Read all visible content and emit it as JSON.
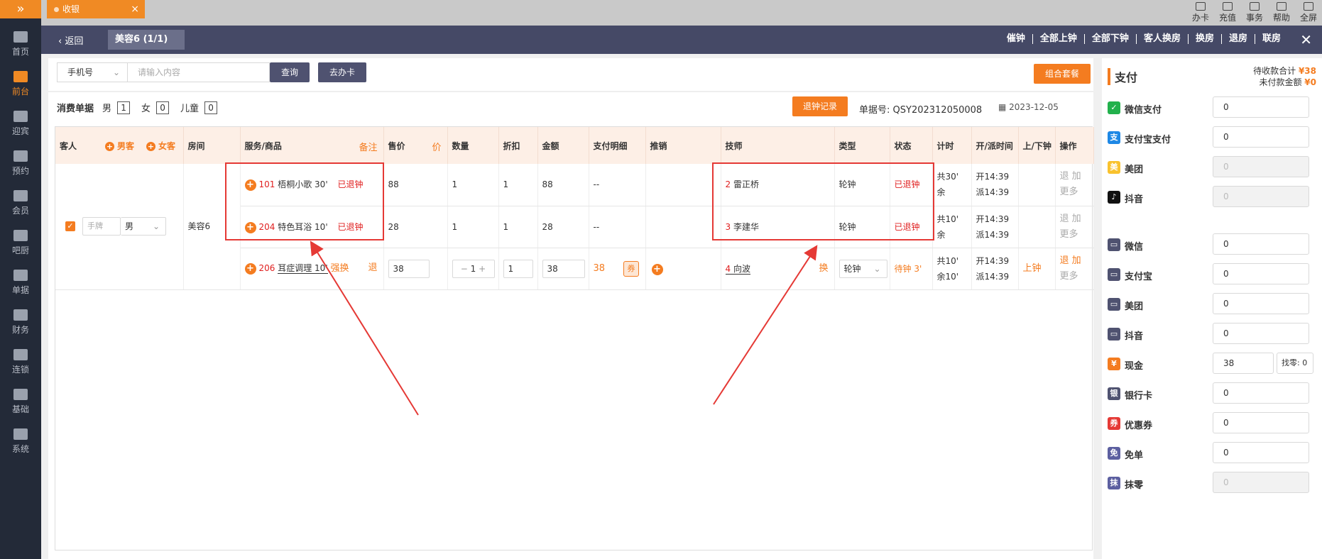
{
  "sidebar": {
    "toggle": "»",
    "items": [
      {
        "label": "首页",
        "icon": "home-icon"
      },
      {
        "label": "前台",
        "icon": "monitor-icon"
      },
      {
        "label": "迎宾",
        "icon": "reception-icon"
      },
      {
        "label": "预约",
        "icon": "calendar-icon"
      },
      {
        "label": "会员",
        "icon": "member-icon"
      },
      {
        "label": "吧厨",
        "icon": "cup-icon"
      },
      {
        "label": "单据",
        "icon": "document-icon"
      },
      {
        "label": "财务",
        "icon": "finance-icon"
      },
      {
        "label": "连锁",
        "icon": "chain-icon"
      },
      {
        "label": "基础",
        "icon": "base-icon"
      },
      {
        "label": "系统",
        "icon": "gear-icon"
      }
    ]
  },
  "topbar": {
    "tab_label": "收银",
    "tab_close": "×",
    "tools": [
      "办卡",
      "充值",
      "事务",
      "帮助",
      "全屏"
    ]
  },
  "navbar": {
    "back_label": "返回",
    "room_tag": "美容6 (1/1)",
    "actions": [
      "催钟",
      "全部上钟",
      "全部下钟",
      "客人换房",
      "换房",
      "退房",
      "联房"
    ],
    "close": "✕"
  },
  "search": {
    "select_value": "手机号",
    "placeholder": "请输入内容",
    "query_label": "查询",
    "card_label": "去办卡",
    "combo_label": "组合套餐"
  },
  "bill": {
    "title": "消费单据",
    "male_label": "男",
    "male_count": "1",
    "female_label": "女",
    "female_count": "0",
    "child_label": "儿童",
    "child_count": "0",
    "record_label": "退钟记录",
    "number_label": "单据号: QSY202312050008",
    "date": "2023-12-05"
  },
  "table": {
    "headers": {
      "guest": "客人",
      "add_male": "男客",
      "add_female": "女客",
      "room": "房间",
      "service": "服务/商品",
      "note": "备注",
      "price": "售价",
      "price_tag": "价",
      "qty": "数量",
      "discount": "折扣",
      "amount": "金额",
      "paydetail": "支付明细",
      "promo": "推销",
      "tech": "技师",
      "type": "类型",
      "status": "状态",
      "timer": "计时",
      "opentime": "开/派时间",
      "updown": "上/下钟",
      "ops": "操作"
    },
    "guest": {
      "hand_placeholder": "手牌",
      "gender": "男",
      "room": "美容6"
    },
    "rows": [
      {
        "code": "101",
        "name": "梧桐小歌 30'",
        "flag": "已退钟",
        "price": "88",
        "qty": "1",
        "discount": "1",
        "amount": "88",
        "paydetail": "--",
        "tech_no": "2",
        "tech_name": "雷正桥",
        "type": "轮钟",
        "status": "已退钟",
        "timer1": "共30'",
        "timer2": "余",
        "open": "开14:39",
        "dispatch": "派14:39",
        "op1": "退 加",
        "op2": "更多"
      },
      {
        "code": "204",
        "name": "特色耳浴 10'",
        "flag": "已退钟",
        "price": "28",
        "qty": "1",
        "discount": "1",
        "amount": "28",
        "paydetail": "--",
        "tech_no": "3",
        "tech_name": "李建华",
        "type": "轮钟",
        "status": "已退钟",
        "timer1": "共10'",
        "timer2": "余",
        "open": "开14:39",
        "dispatch": "派14:39",
        "op1": "退 加",
        "op2": "更多"
      },
      {
        "code": "206",
        "name": "耳症调理 10'",
        "flag": "强换",
        "flag2": "退",
        "price": "38",
        "qty": "1",
        "discount": "1",
        "amount": "38",
        "paydetail": "38",
        "coupon": "券",
        "tech_no": "4",
        "tech_name": "向波",
        "tech_swap": "换",
        "type": "轮钟",
        "status": "待钟 3'",
        "timer1": "共10'",
        "timer2": "余10'",
        "open": "开14:39",
        "dispatch": "派14:39",
        "updown": "上钟",
        "op1": "退 加",
        "op2": "更多"
      }
    ]
  },
  "pay": {
    "title": "支付",
    "due_label": "待收款合计",
    "due_value": "¥38",
    "unpaid_label": "未付款金额",
    "unpaid_value": "¥0",
    "methods": [
      {
        "label": "微信支付",
        "value": "0",
        "icon": "wechat-pay-icon",
        "color": "#22b14c",
        "mark": "✓",
        "disabled": false
      },
      {
        "label": "支付宝支付",
        "value": "0",
        "icon": "alipay-icon",
        "color": "#1e88e5",
        "mark": "支",
        "disabled": false
      },
      {
        "label": "美团",
        "value": "0",
        "icon": "meituan-icon",
        "color": "#f9c22e",
        "mark": "美",
        "disabled": true
      },
      {
        "label": "抖音",
        "value": "0",
        "icon": "douyin-icon",
        "color": "#111111",
        "mark": "♪",
        "disabled": true
      },
      {
        "label": "微信",
        "value": "0",
        "icon": "wechat-icon",
        "color": "#4f5270",
        "mark": "▭",
        "disabled": false
      },
      {
        "label": "支付宝",
        "value": "0",
        "icon": "alipay-plain-icon",
        "color": "#4f5270",
        "mark": "▭",
        "disabled": false
      },
      {
        "label": "美团",
        "value": "0",
        "icon": "meituan-plain-icon",
        "color": "#4f5270",
        "mark": "▭",
        "disabled": false
      },
      {
        "label": "抖音",
        "value": "0",
        "icon": "douyin-plain-icon",
        "color": "#4f5270",
        "mark": "▭",
        "disabled": false
      },
      {
        "label": "现金",
        "value": "38",
        "icon": "cash-icon",
        "color": "#f47c20",
        "mark": "¥",
        "disabled": false,
        "change_label": "找零: 0"
      },
      {
        "label": "银行卡",
        "value": "0",
        "icon": "bank-card-icon",
        "color": "#4f5270",
        "mark": "银",
        "disabled": false
      },
      {
        "label": "优惠券",
        "value": "0",
        "icon": "coupon-icon",
        "color": "#e53935",
        "mark": "券",
        "disabled": false
      },
      {
        "label": "免单",
        "value": "0",
        "icon": "free-order-icon",
        "color": "#5c5fa0",
        "mark": "免",
        "disabled": false
      },
      {
        "label": "抹零",
        "value": "0",
        "icon": "round-off-icon",
        "color": "#5c5fa0",
        "mark": "抹",
        "disabled": true
      }
    ]
  }
}
